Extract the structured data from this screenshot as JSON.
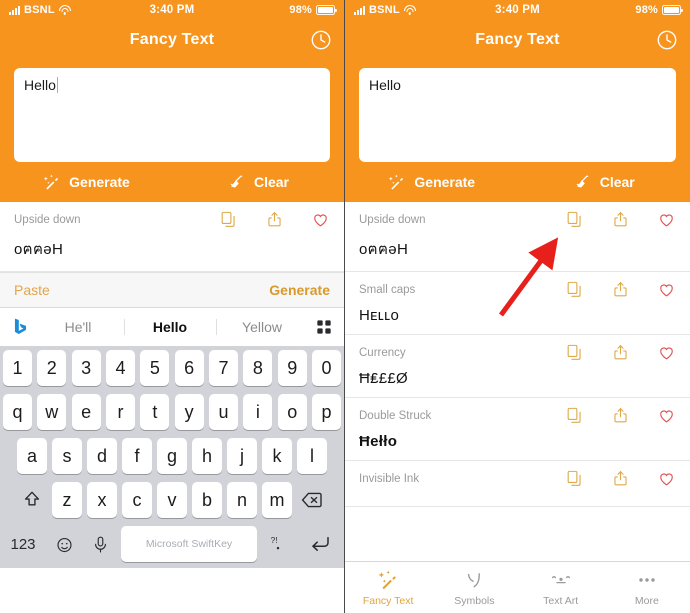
{
  "status_bar": {
    "carrier": "BSNL",
    "time": "3:40 PM",
    "battery": "98%",
    "signal_icon": "cellular-signal-icon",
    "wifi_icon": "wifi-icon",
    "battery_icon": "battery-icon"
  },
  "nav": {
    "title": "Fancy Text",
    "history_icon": "clock-history-icon"
  },
  "composer": {
    "text": "Hello",
    "generate_label": "Generate",
    "clear_label": "Clear",
    "generate_icon": "magic-wand-icon",
    "clear_icon": "broom-icon"
  },
  "paste_bar": {
    "paste_label": "Paste",
    "generate_label": "Generate"
  },
  "row_icons": {
    "copy": "copy-icon",
    "share": "share-icon",
    "favorite": "heart-icon"
  },
  "results_left": [
    {
      "label": "Upside down",
      "value": "oฅฅǝH"
    }
  ],
  "results_right": [
    {
      "label": "Upside down",
      "value": "oฅฅǝH"
    },
    {
      "label": "Small caps",
      "value": "Hᴇʟʟᴏ"
    },
    {
      "label": "Currency",
      "value": "Ħ₤££Ø"
    },
    {
      "label": "Double Struck",
      "value": "Ħełło"
    },
    {
      "label": "Invisible Ink",
      "value": ""
    }
  ],
  "keyboard": {
    "suggestions": [
      "He'll",
      "Hello",
      "Yellow"
    ],
    "bold_suggestion_index": 1,
    "bing_icon": "bing-logo-icon",
    "grid_icon": "grid-menu-icon",
    "row_numbers": [
      "1",
      "2",
      "3",
      "4",
      "5",
      "6",
      "7",
      "8",
      "9",
      "0"
    ],
    "row_top": [
      "q",
      "w",
      "e",
      "r",
      "t",
      "y",
      "u",
      "i",
      "o",
      "p"
    ],
    "row_mid": [
      "a",
      "s",
      "d",
      "f",
      "g",
      "h",
      "j",
      "k",
      "l"
    ],
    "row_low": [
      "z",
      "x",
      "c",
      "v",
      "b",
      "n",
      "m"
    ],
    "shift_icon": "shift-arrow-icon",
    "backspace_icon": "backspace-icon",
    "numeric_label": "123",
    "emoji_icon": "emoji-smiley-icon",
    "mic_icon": "microphone-icon",
    "space_label": "Microsoft SwiftKey",
    "punct_label": "?!\n.",
    "enter_icon": "return-arrow-icon"
  },
  "tabs": [
    {
      "label": "Fancy Text",
      "icon": "sparkle-wand-icon",
      "active": true
    },
    {
      "label": "Symbols",
      "icon": "symbols-tsu-icon",
      "active": false
    },
    {
      "label": "Text Art",
      "icon": "text-art-face-icon",
      "active": false
    },
    {
      "label": "More",
      "icon": "more-dots-icon",
      "active": false
    }
  ],
  "annotation": {
    "arrow": "red-arrow-pointing-to-copy-icon"
  },
  "colors": {
    "brand_orange": "#F7941E",
    "gold_icon": "#DDA94A",
    "heart_red": "#E0504F",
    "arrow_red": "#E8201C"
  }
}
